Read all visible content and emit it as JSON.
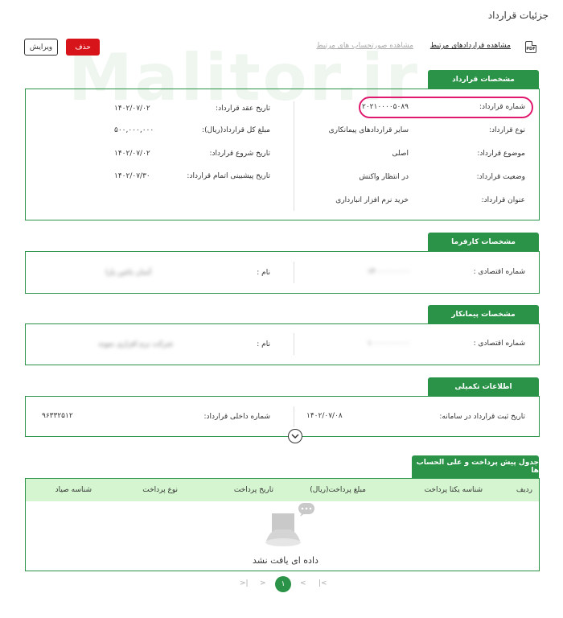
{
  "page": {
    "title": "جزئیات قرارداد",
    "watermark": "Malitor.ir"
  },
  "toolbar": {
    "pdf_label": "PDF",
    "link_related_contracts": "مشاهده قراردادهای مرتبط",
    "link_related_invoices": "مشاهده صورتحساب های مرتبط",
    "delete_label": "حذف",
    "edit_label": "ویرایش"
  },
  "contract": {
    "header": "مشخصات قرارداد",
    "right": [
      {
        "label": "شماره قرارداد:",
        "value": "۲۰۲۱۰۰۰۰۵۰۸۹"
      },
      {
        "label": "نوع قرارداد:",
        "value": "سایر قراردادهای پیمانکاری"
      },
      {
        "label": "موضوع قرارداد:",
        "value": "اصلی"
      },
      {
        "label": "وضعیت قرارداد:",
        "value": "در انتظار واکنش"
      },
      {
        "label": "عنوان قرارداد:",
        "value": "خرید نرم افزار انبارداری"
      }
    ],
    "left": [
      {
        "label": "تاریخ عقد قرارداد:",
        "value": "۱۴۰۲/۰۷/۰۲"
      },
      {
        "label": "مبلغ کل قرارداد(ریال):",
        "value": "۵۰۰,۰۰۰,۰۰۰"
      },
      {
        "label": "تاریخ شروع قرارداد:",
        "value": "۱۴۰۲/۰۷/۰۲"
      },
      {
        "label": "تاریخ پیشبینی اتمام قرارداد:",
        "value": "۱۴۰۲/۰۷/۳۰"
      }
    ]
  },
  "employer": {
    "header": "مشخصات کارفرما",
    "econ_label": "شماره اقتصادی :",
    "econ_value": "۱۴۰۰۰۰۰۰۰۰۰",
    "name_label": "نام :",
    "name_value": "آسان باغین پارا"
  },
  "contractor": {
    "header": "مشخصات پیمانکار",
    "econ_label": "شماره اقتصادی :",
    "econ_value": "۱۰۰۰۰۰۰۰۰۰۰",
    "name_label": "نام :",
    "name_value": "شرکت نرم افزاری نمونه"
  },
  "extra": {
    "header": "اطلاعات تکمیلی",
    "reg_label": "تاریخ ثبت قرارداد در سامانه:",
    "reg_value": "۱۴۰۲/۰۷/۰۸",
    "internal_label": "شماره داخلی قرارداد:",
    "internal_value": "۹۶۳۳۲۵۱۲"
  },
  "payments": {
    "header": "جدول پیش پرداخت و علی الحساب ها",
    "columns": [
      "ردیف",
      "شناسه یکتا پرداخت",
      "مبلغ پرداخت(ریال)",
      "تاریخ پرداخت",
      "نوع پرداخت",
      "شناسه صیاد"
    ],
    "empty_text": "داده ای یافت نشد"
  },
  "pagination": {
    "first": "|<",
    "prev": "<",
    "current": "۱",
    "next": ">",
    "last": ">|"
  },
  "colors": {
    "accent": "#2b9348",
    "danger": "#d8141b",
    "highlight": "#e0186e",
    "table_header": "#d4f5cf"
  }
}
